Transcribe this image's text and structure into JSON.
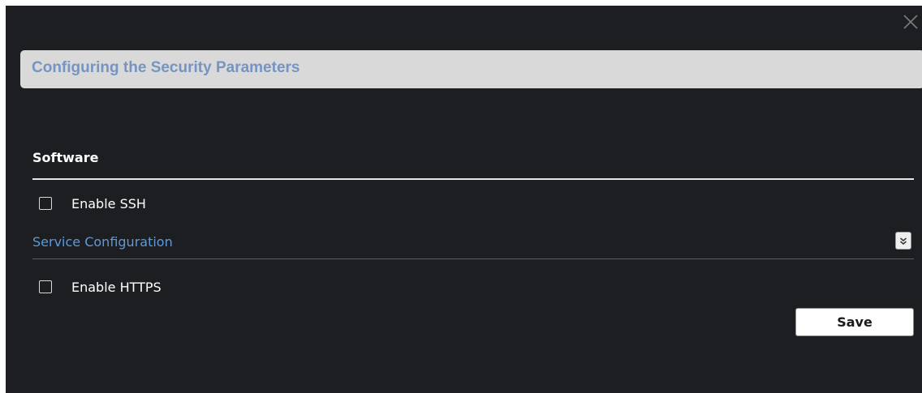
{
  "dialog": {
    "title": "Configuring the Security Parameters",
    "close_icon": "close-icon"
  },
  "software": {
    "heading": "Software",
    "enable_ssh": {
      "label": "Enable SSH",
      "checked": false
    }
  },
  "service_configuration": {
    "label": "Service Configuration",
    "expand_icon": "double-chevron-down-icon",
    "enable_https": {
      "label": "Enable HTTPS",
      "checked": false
    }
  },
  "actions": {
    "save_label": "Save"
  },
  "colors": {
    "dialog_background": "#1c1e21",
    "title_bar_background": "#d9d9d9",
    "title_text": "#7694c2",
    "link_text": "#5e9ad8"
  }
}
